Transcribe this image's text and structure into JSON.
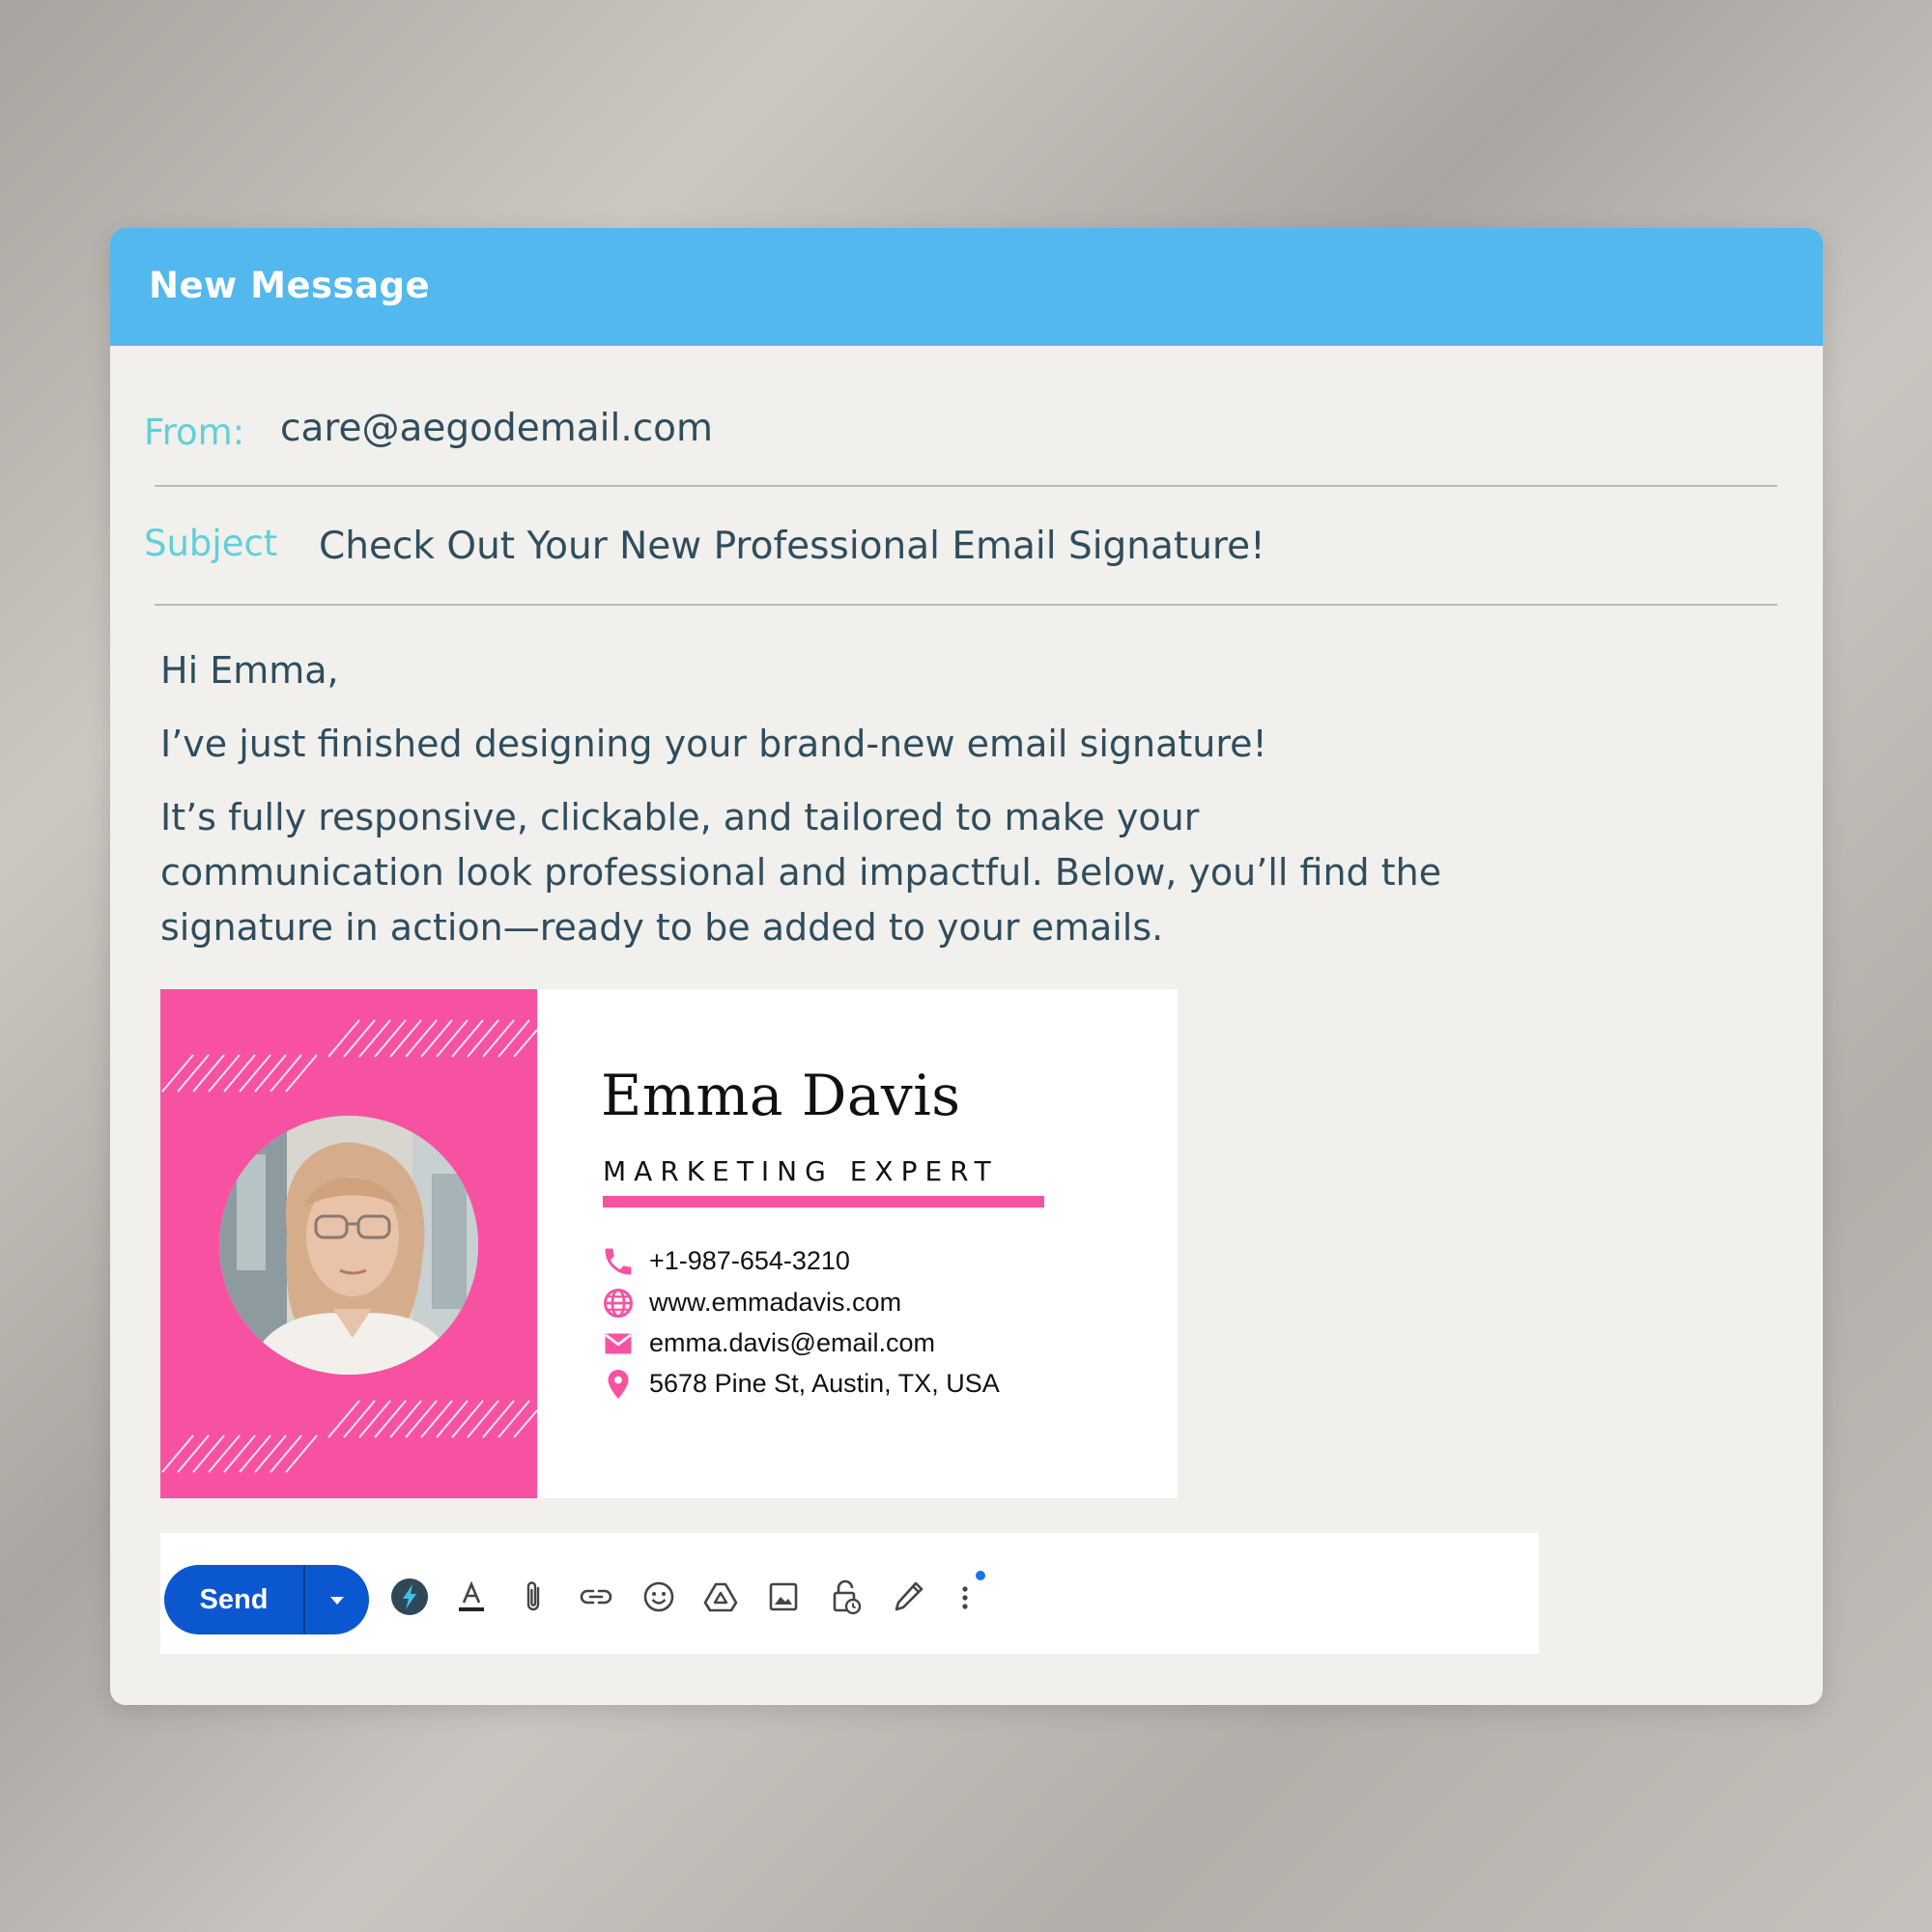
{
  "window": {
    "title": "New Message"
  },
  "from": {
    "label": "From:",
    "value": "care@aegodemail.com"
  },
  "subject": {
    "label": "Subject",
    "value": "Check Out Your New Professional Email Signature!"
  },
  "body": {
    "greeting": "Hi Emma,",
    "line1": "I’ve just finished designing your brand-new email signature!",
    "para_lines": [
      "It’s fully responsive, clickable, and tailored to make your",
      "communication look professional and impactful. Below, you’ll find the",
      "signature in action—ready to be added to your emails."
    ]
  },
  "signature": {
    "name": "Emma Davis",
    "role": "MARKETING EXPERT",
    "accent_color": "#f752a2",
    "contacts": [
      {
        "icon": "phone-icon",
        "text": "+1-987-654-3210"
      },
      {
        "icon": "globe-icon",
        "text": "www.emmadavis.com"
      },
      {
        "icon": "mail-icon",
        "text": "emma.davis@email.com"
      },
      {
        "icon": "location-pin-icon",
        "text": "5678 Pine St, Austin, TX, USA"
      }
    ]
  },
  "toolbar": {
    "send_label": "Send",
    "icons": [
      "ai-spark-icon",
      "text-format-icon",
      "attachment-icon",
      "link-icon",
      "emoji-icon",
      "drive-icon",
      "image-icon",
      "confidential-lock-icon",
      "signature-pen-icon",
      "more-options-icon"
    ]
  },
  "colors": {
    "titlebar": "#52b8ee",
    "label": "#5fd0d8",
    "text": "#2f4d5e",
    "send_button": "#0b57d0"
  }
}
